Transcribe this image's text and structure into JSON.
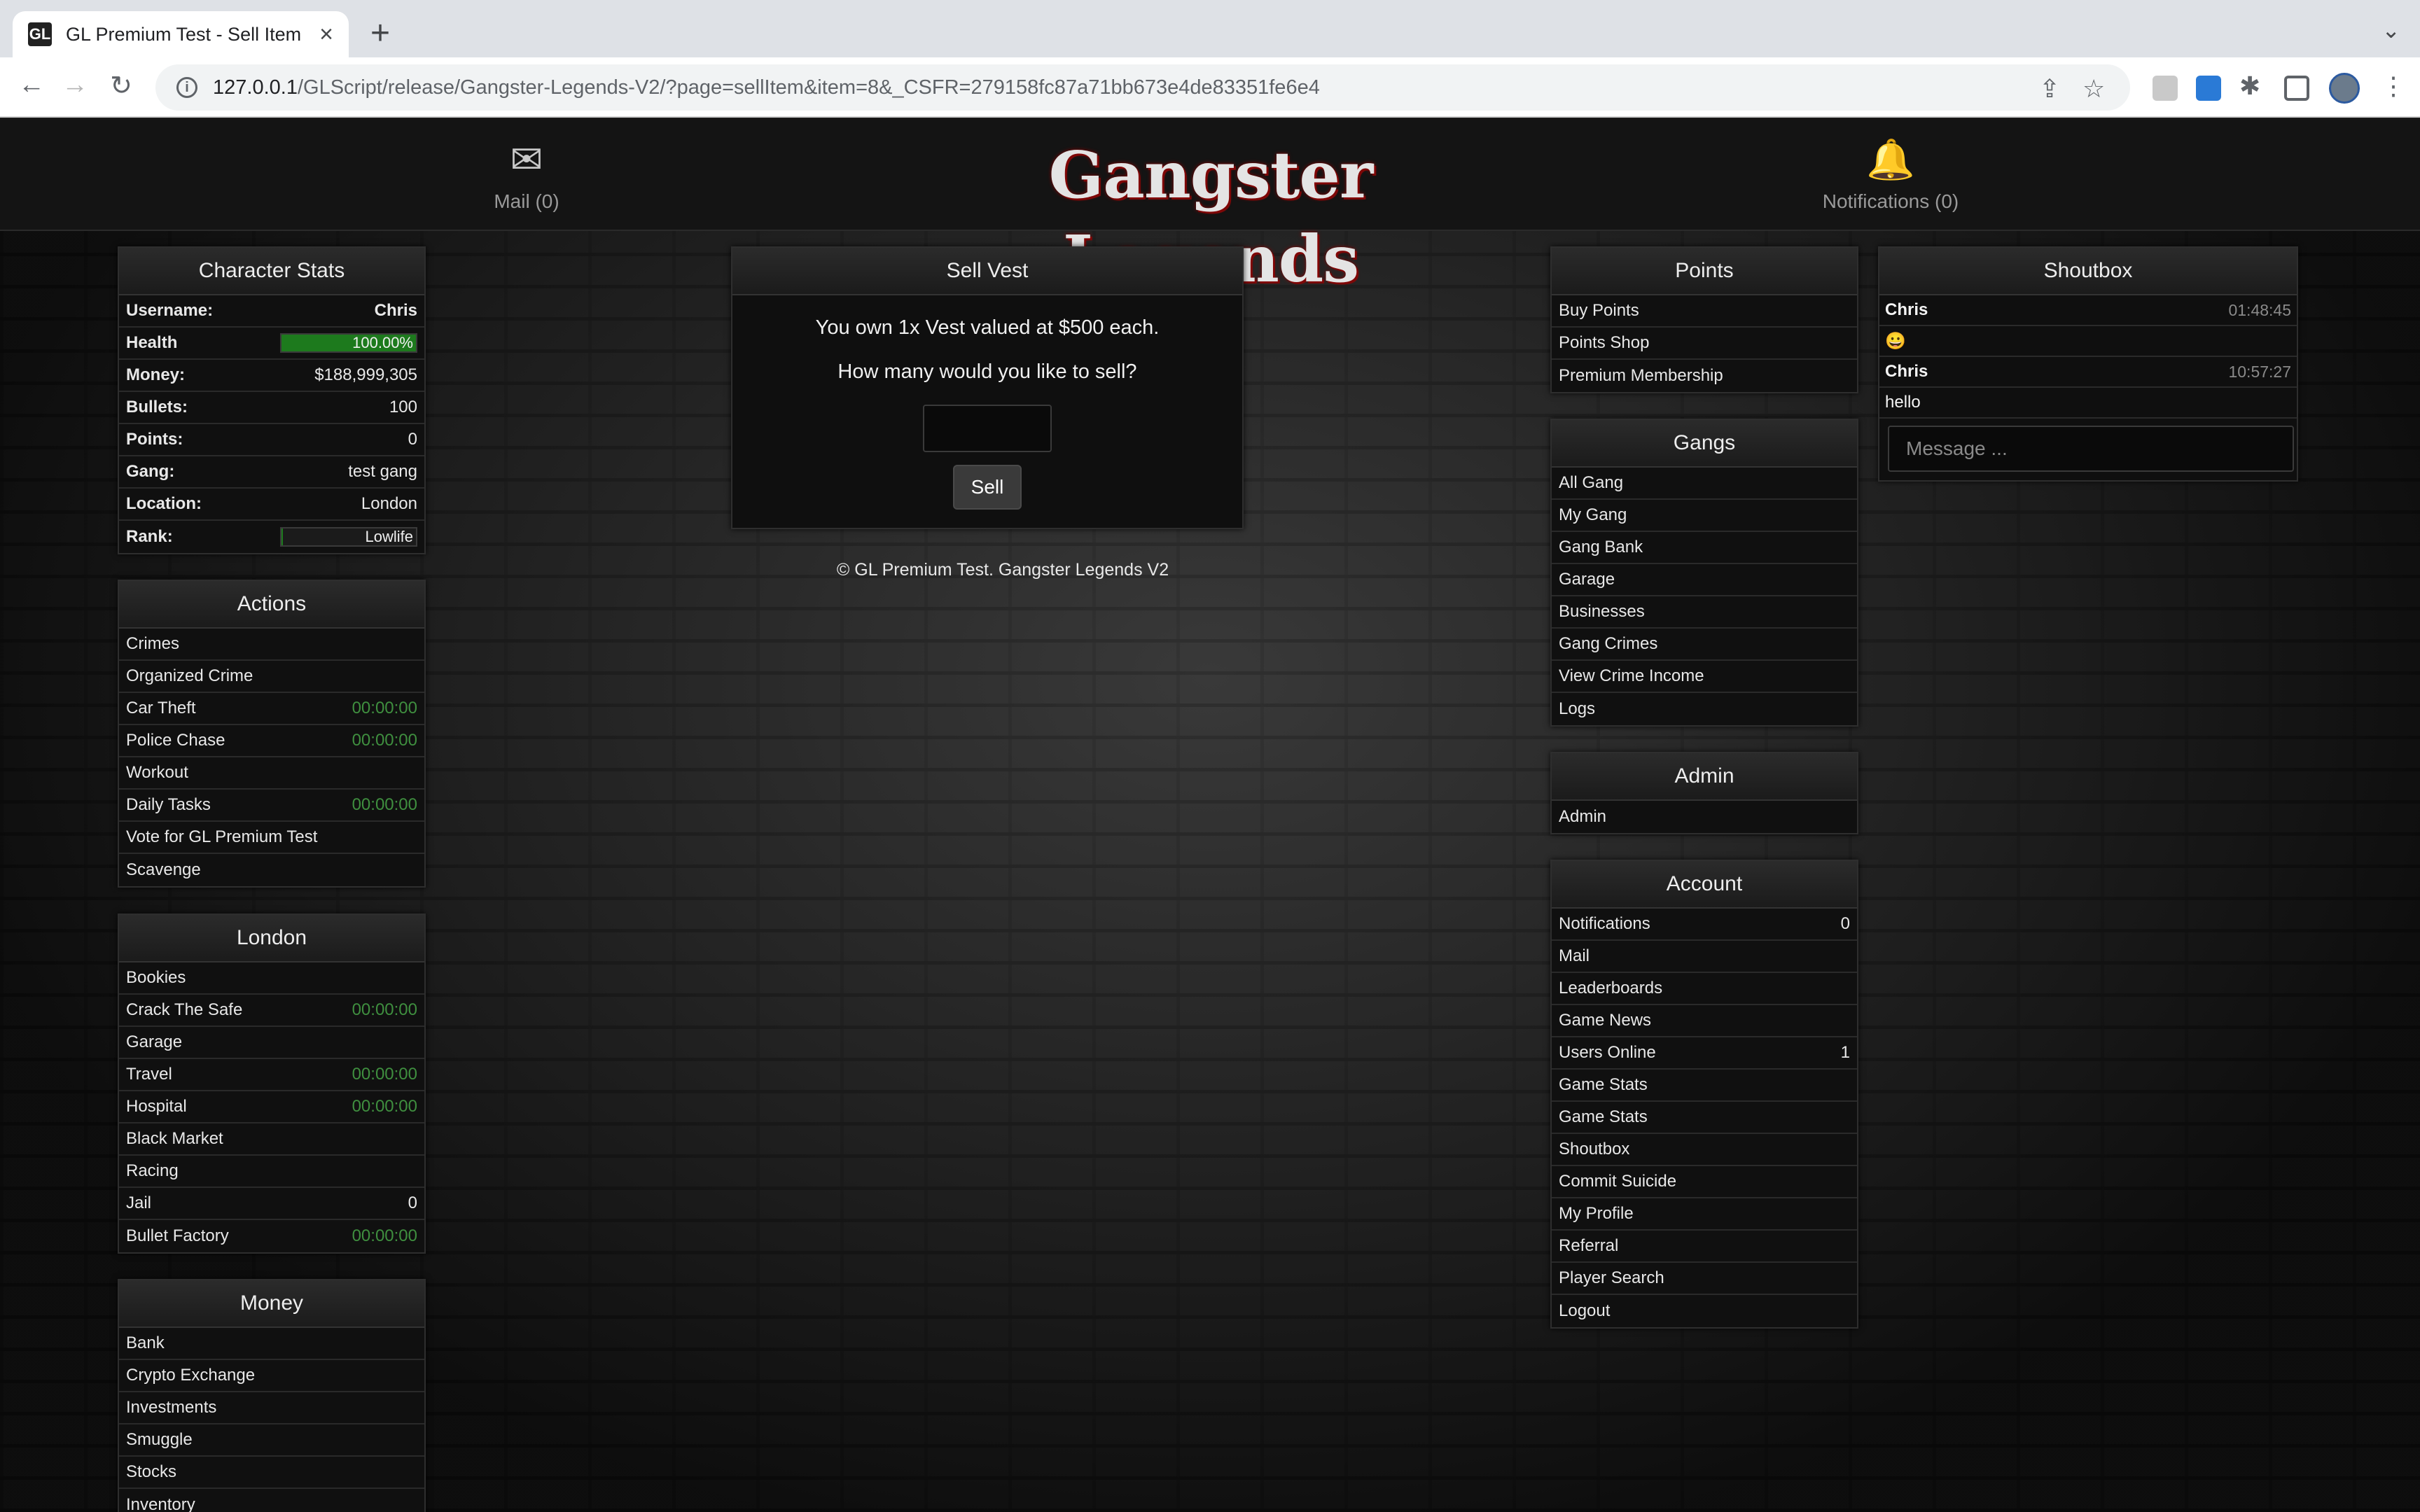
{
  "browser": {
    "tab_title": "GL Premium Test - Sell Item",
    "tab_favicon": "GL",
    "url_host": "127.0.0.1",
    "url_path": "/GLScript/release/Gangster-Legends-V2/?page=sellItem&item=8&_CSFR=279158fc87a71bb673e4de83351fe6e4"
  },
  "header": {
    "mail_label": "Mail (0)",
    "logo_text": "Gangster Legends",
    "notifications_label": "Notifications (0)"
  },
  "character_stats": {
    "title": "Character Stats",
    "username_label": "Username:",
    "username": "Chris",
    "health_label": "Health",
    "health_text": "100.00%",
    "health_fraction": 1.0,
    "money_label": "Money:",
    "money": "$188,999,305",
    "bullets_label": "Bullets:",
    "bullets": "100",
    "points_label": "Points:",
    "points": "0",
    "gang_label": "Gang:",
    "gang": "test gang",
    "location_label": "Location:",
    "location": "London",
    "rank_label": "Rank:",
    "rank": "Lowlife",
    "rank_fraction": 0.01
  },
  "actions": {
    "title": "Actions",
    "items": [
      {
        "label": "Crimes",
        "timer": ""
      },
      {
        "label": "Organized Crime",
        "timer": ""
      },
      {
        "label": "Car Theft",
        "timer": "00:00:00"
      },
      {
        "label": "Police Chase",
        "timer": "00:00:00"
      },
      {
        "label": "Workout",
        "timer": ""
      },
      {
        "label": "Daily Tasks",
        "timer": "00:00:00"
      },
      {
        "label": "Vote for GL Premium Test",
        "timer": ""
      },
      {
        "label": "Scavenge",
        "timer": ""
      }
    ]
  },
  "london": {
    "title": "London",
    "items": [
      {
        "label": "Bookies",
        "timer": ""
      },
      {
        "label": "Crack The Safe",
        "timer": "00:00:00"
      },
      {
        "label": "Garage",
        "timer": ""
      },
      {
        "label": "Travel",
        "timer": "00:00:00"
      },
      {
        "label": "Hospital",
        "timer": "00:00:00"
      },
      {
        "label": "Black Market",
        "timer": ""
      },
      {
        "label": "Racing",
        "timer": ""
      },
      {
        "label": "Jail",
        "count": "0"
      },
      {
        "label": "Bullet Factory",
        "timer": "00:00:00"
      }
    ]
  },
  "money_menu": {
    "title": "Money",
    "items": [
      "Bank",
      "Crypto Exchange",
      "Investments",
      "Smuggle",
      "Stocks",
      "Inventory"
    ]
  },
  "sell": {
    "title": "Sell Vest",
    "own_text": "You own 1x Vest valued at $500 each.",
    "question": "How many would you like to sell?",
    "quantity_value": "",
    "button_label": "Sell"
  },
  "footer": {
    "text": "© GL Premium Test. Gangster Legends V2"
  },
  "points_menu": {
    "title": "Points",
    "items": [
      "Buy Points",
      "Points Shop",
      "Premium Membership"
    ]
  },
  "gangs_menu": {
    "title": "Gangs",
    "items": [
      "All Gang",
      "My Gang",
      "Gang Bank",
      "Garage",
      "Businesses",
      "Gang Crimes",
      "View Crime Income",
      "Logs"
    ]
  },
  "admin_menu": {
    "title": "Admin",
    "items": [
      "Admin"
    ]
  },
  "account_menu": {
    "title": "Account",
    "items": [
      {
        "label": "Notifications",
        "count": "0"
      },
      {
        "label": "Mail",
        "count": ""
      },
      {
        "label": "Leaderboards",
        "count": ""
      },
      {
        "label": "Game News",
        "count": ""
      },
      {
        "label": "Users Online",
        "count": "1"
      },
      {
        "label": "Game Stats",
        "count": ""
      },
      {
        "label": "Game Stats",
        "count": ""
      },
      {
        "label": "Shoutbox",
        "count": ""
      },
      {
        "label": "Commit Suicide",
        "count": ""
      },
      {
        "label": "My Profile",
        "count": ""
      },
      {
        "label": "Referral",
        "count": ""
      },
      {
        "label": "Player Search",
        "count": ""
      },
      {
        "label": "Logout",
        "count": ""
      }
    ]
  },
  "shoutbox": {
    "title": "Shoutbox",
    "messages": [
      {
        "user": "Chris",
        "time": "01:48:45",
        "text": "😀"
      },
      {
        "user": "Chris",
        "time": "10:57:27",
        "text": "hello"
      }
    ],
    "input_placeholder": "Message ..."
  }
}
